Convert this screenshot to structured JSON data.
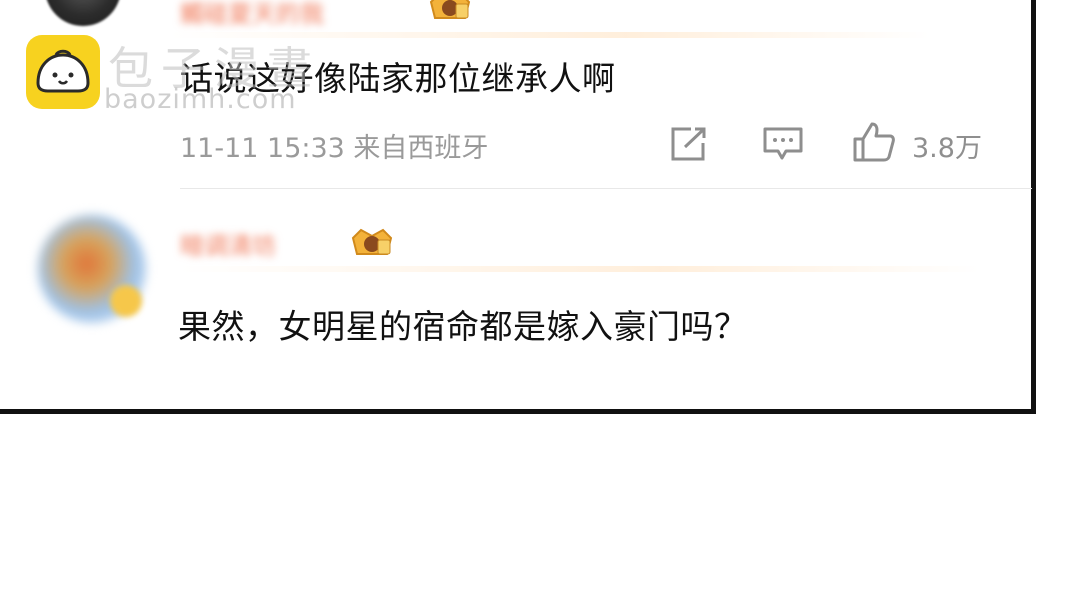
{
  "watermark": {
    "title": "包子漫畫",
    "url": "baozimh.com"
  },
  "comments": [
    {
      "username": "觸碰夏天的我",
      "text": "话说这好像陆家那位继承人啊",
      "time_location": "11-11 15:33 来自西班牙",
      "like_count": "3.8万"
    },
    {
      "username": "暗调清坊",
      "text": "果然，女明星的宿命都是嫁入豪门吗？"
    }
  ],
  "icons": {
    "share": "share-icon",
    "comment": "comment-icon",
    "like": "thumbs-up-icon",
    "crown": "crown-badge-icon",
    "logo": "bun-logo-icon"
  },
  "colors": {
    "username": "#f07a5a",
    "meta": "#9a9a9a",
    "text": "#111111",
    "border": "#111111",
    "logo": "#f7d21f"
  }
}
